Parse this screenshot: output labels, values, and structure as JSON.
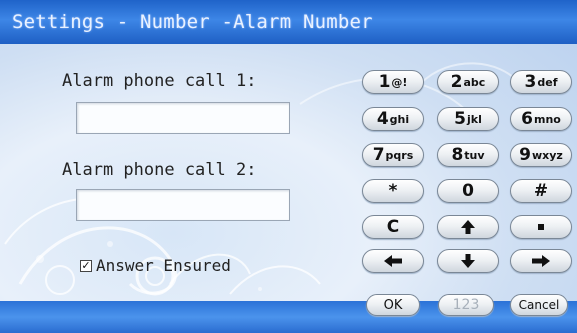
{
  "window": {
    "title": "Settings - Number -Alarm Number"
  },
  "form": {
    "alarm1_label": "Alarm phone call 1:",
    "alarm1_value": "",
    "alarm2_label": "Alarm phone call 2:",
    "alarm2_value": "",
    "answer_ensured_label": "Answer Ensured",
    "answer_ensured_checked": true,
    "check_mark": "✓"
  },
  "keypad": {
    "k1": {
      "digit": "1",
      "letters": "@!"
    },
    "k2": {
      "digit": "2",
      "letters": "abc"
    },
    "k3": {
      "digit": "3",
      "letters": "def"
    },
    "k4": {
      "digit": "4",
      "letters": "ghi"
    },
    "k5": {
      "digit": "5",
      "letters": "jkl"
    },
    "k6": {
      "digit": "6",
      "letters": "mno"
    },
    "k7": {
      "digit": "7",
      "letters": "pqrs"
    },
    "k8": {
      "digit": "8",
      "letters": "tuv"
    },
    "k9": {
      "digit": "9",
      "letters": "wxyz"
    },
    "star": "*",
    "zero": "0",
    "hash": "#",
    "clear": "C",
    "ok": "OK",
    "mode": "123",
    "cancel": "Cancel"
  },
  "icons": {
    "up": "up-arrow-icon",
    "down": "down-arrow-icon",
    "left": "left-arrow-icon",
    "right": "right-arrow-icon",
    "dot": "dot-icon"
  },
  "colors": {
    "title_bar": "#2f78de",
    "bottom_bar": "#3a82e2",
    "background": "#dde9f7"
  }
}
